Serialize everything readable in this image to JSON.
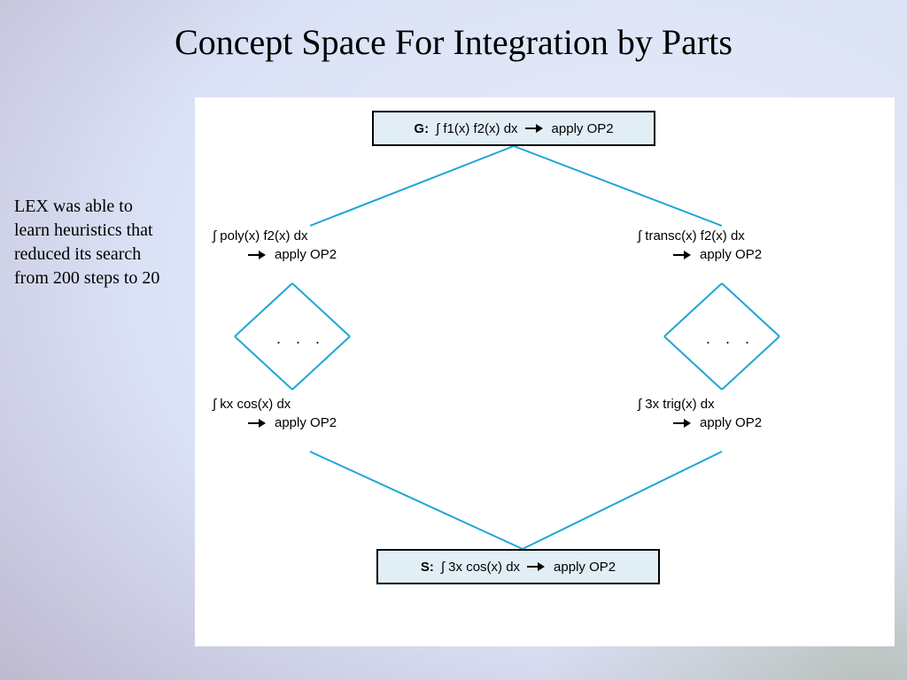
{
  "title": "Concept Space For Integration by Parts",
  "sidebar_text": "LEX was able to learn heuristics that reduced its search from 200 steps to 20",
  "diagram": {
    "top_box": {
      "label": "G:",
      "expr": "∫ f1(x) f2(x) dx",
      "action": "apply OP2"
    },
    "bottom_box": {
      "label": "S:",
      "expr": "∫ 3x cos(x) dx",
      "action": "apply OP2"
    },
    "left_upper": {
      "expr": "∫ poly(x) f2(x) dx",
      "action": "apply OP2"
    },
    "right_upper": {
      "expr": "∫ transc(x) f2(x) dx",
      "action": "apply OP2"
    },
    "left_lower": {
      "expr": "∫ kx cos(x) dx",
      "action": "apply OP2"
    },
    "right_lower": {
      "expr": "∫ 3x trig(x) dx",
      "action": "apply OP2"
    },
    "ellipsis": ". . ."
  }
}
